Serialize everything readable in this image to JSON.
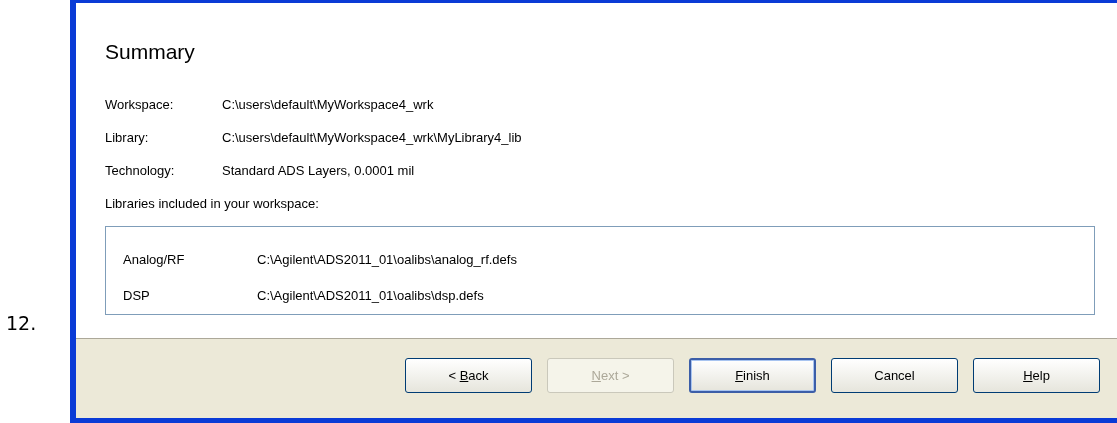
{
  "step_number": "12.",
  "dialog": {
    "heading": "Summary",
    "fields": [
      {
        "label": "Workspace:",
        "value": "C:\\users\\default\\MyWorkspace4_wrk"
      },
      {
        "label": "Library:",
        "value": "C:\\users\\default\\MyWorkspace4_wrk\\MyLibrary4_lib"
      },
      {
        "label": "Technology:",
        "value": "Standard ADS Layers, 0.0001 mil"
      }
    ],
    "libraries_caption": "Libraries included in your workspace:",
    "libraries": [
      {
        "name": "Analog/RF",
        "path": "C:\\Agilent\\ADS2011_01\\oalibs\\analog_rf.defs"
      },
      {
        "name": "DSP",
        "path": "C:\\Agilent\\ADS2011_01\\oalibs\\dsp.defs"
      }
    ],
    "buttons": [
      {
        "label_before": "< ",
        "access_key": "B",
        "label_after": "ack",
        "disabled": false,
        "default": false
      },
      {
        "access_key": "N",
        "label_after": "ext >",
        "disabled": true,
        "default": false
      },
      {
        "access_key": "F",
        "label_after": "inish",
        "disabled": false,
        "default": true
      },
      {
        "label_before": "Cancel",
        "disabled": false,
        "default": false
      },
      {
        "access_key": "H",
        "label_after": "elp",
        "disabled": false,
        "default": false
      }
    ]
  }
}
